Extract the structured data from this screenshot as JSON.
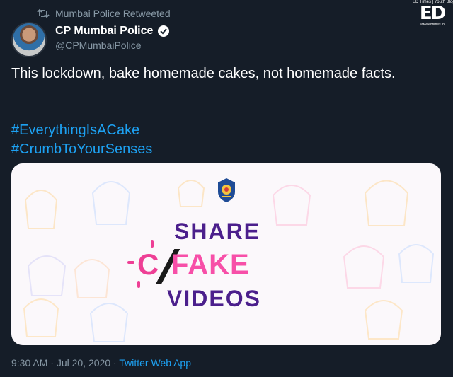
{
  "retweet": {
    "label": "Mumbai Police Retweeted",
    "icon": "retweet-icon"
  },
  "author": {
    "name": "CP Mumbai Police",
    "handle": "@CPMumbaiPolice",
    "verified_icon": "verified-badge-icon",
    "avatar_alt": "profile photo"
  },
  "brand": {
    "top": "ED Times | Youth Blog",
    "logo": "ED",
    "url": "www.edtimes.in"
  },
  "tweet": {
    "text": "This lockdown, bake homemade cakes, not homemade facts.",
    "hashtags": [
      "#EverythingIsACake",
      "#CrumbToYourSenses"
    ]
  },
  "media": {
    "line1": "SHARE",
    "line2_c": "C",
    "line2_fake": "FAKE",
    "line3": "VIDEOS",
    "emblem_icon": "mumbai-police-emblem-icon"
  },
  "footer": {
    "time": "9:30 AM",
    "separator1": " · ",
    "date": "Jul 20, 2020",
    "separator2": " · ",
    "source": "Twitter Web App"
  },
  "colors": {
    "background": "#151d28",
    "link": "#1da1f2",
    "muted": "#8899a6",
    "purple": "#4b1f8c",
    "pink": "#f74fa8"
  }
}
